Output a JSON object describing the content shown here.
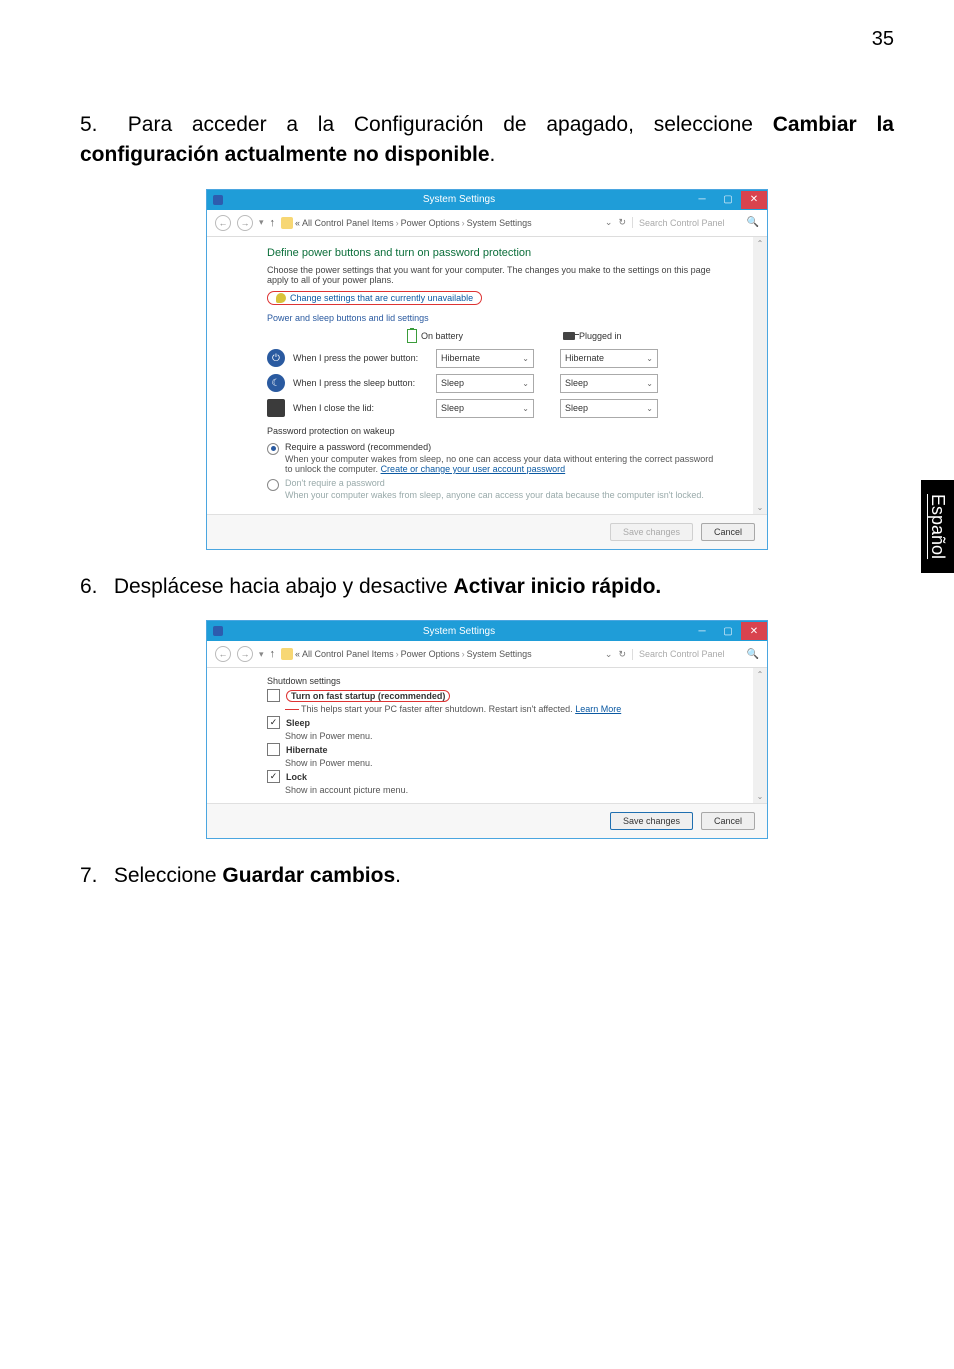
{
  "page_number": "35",
  "side_tab": "Español",
  "step5": {
    "num": "5.",
    "text_before": " Para acceder a la Configuración de apagado, seleccione ",
    "bold1": "Cambiar la configuración actualmente no disponible",
    "period": "."
  },
  "step6": {
    "num": "6.",
    "text_before": " Desplácese hacia abajo y desactive ",
    "bold1": "Activar inicio rápido.",
    "period": ""
  },
  "step7": {
    "num": "7.",
    "text_before": " Seleccione ",
    "bold1": "Guardar cambios",
    "period": "."
  },
  "win1": {
    "title": "System Settings",
    "crumb_prefix": "«",
    "crumb1": "All Control Panel Items",
    "crumb2": "Power Options",
    "crumb3": "System Settings",
    "search_placeholder": "Search Control Panel",
    "heading": "Define power buttons and turn on password protection",
    "intro": "Choose the power settings that you want for your computer. The changes you make to the settings on this page apply to all of your power plans.",
    "change_link": "Change settings that are currently unavailable",
    "fs_title": "Power and sleep buttons and lid settings",
    "col_battery": "On battery",
    "col_plugged": "Plugged in",
    "row_power": "When I press the power button:",
    "row_sleep": "When I press the sleep button:",
    "row_lid": "When I close the lid:",
    "val_power_b": "Hibernate",
    "val_power_p": "Hibernate",
    "val_sleep_b": "Sleep",
    "val_sleep_p": "Sleep",
    "val_lid_b": "Sleep",
    "val_lid_p": "Sleep",
    "pw_group": "Password protection on wakeup",
    "r1_title": "Require a password (recommended)",
    "r1_desc1": "When your computer wakes from sleep, no one can access your data without entering the correct password to unlock the computer. ",
    "r1_link": "Create or change your user account password",
    "r2_title": "Don't require a password",
    "r2_desc": "When your computer wakes from sleep, anyone can access your data because the computer isn't locked.",
    "btn_save": "Save changes",
    "btn_cancel": "Cancel"
  },
  "win2": {
    "title": "System Settings",
    "crumb_prefix": "«",
    "crumb1": "All Control Panel Items",
    "crumb2": "Power Options",
    "crumb3": "System Settings",
    "search_placeholder": "Search Control Panel",
    "group": "Shutdown settings",
    "opt_fast": "Turn on fast startup (recommended)",
    "fast_desc1": "This helps start your PC faster after shutdown. Restart isn't affected. ",
    "fast_link": "Learn More",
    "opt_sleep": "Sleep",
    "sleep_desc": "Show in Power menu.",
    "opt_hib": "Hibernate",
    "hib_desc": "Show in Power menu.",
    "opt_lock": "Lock",
    "lock_desc": "Show in account picture menu.",
    "btn_save": "Save changes",
    "btn_cancel": "Cancel"
  }
}
